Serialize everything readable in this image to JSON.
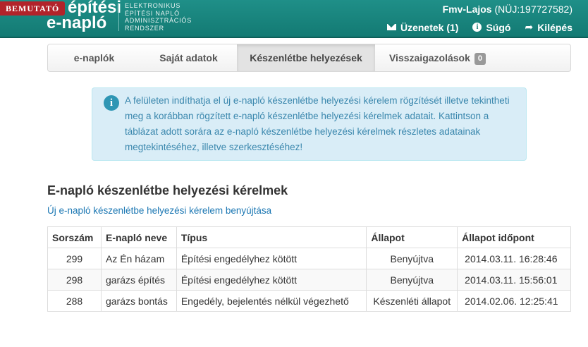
{
  "header": {
    "badge": "BEMUTATÓ",
    "logo_line1": "építési",
    "logo_line2": "e-napló",
    "logo_sub": [
      "ELEKTRONIKUS",
      "ÉPÍTÉSI NAPLÓ",
      "ADMINISZTRÁCIÓS",
      "RENDSZER"
    ],
    "user_name": "Fmv-Lajos",
    "user_id": "(NÜJ:197727582)",
    "nav": {
      "messages": "Üzenetek (1)",
      "help": "Súgó",
      "logout": "Kilépés"
    }
  },
  "tabs": [
    {
      "label": "e-naplók"
    },
    {
      "label": "Saját adatok"
    },
    {
      "label": "Készenlétbe helyezések"
    },
    {
      "label": "Visszaigazolások",
      "count": "0"
    }
  ],
  "info": {
    "icon": "info-icon",
    "text": "A felületen indíthatja el új e-napló készenlétbe helyezési kérelem rögzítését illetve tekintheti meg a korábban rögzített e-napló készenlétbe helyezési kérelmek adatait. Kattintson a táblázat adott sorára az e-napló készenlétbe helyezési kérelmek részletes adatainak megtekintéséhez, illetve szerkesztéséhez!"
  },
  "section": {
    "title": "E-napló készenlétbe helyezési kérelmek",
    "new_link": "Új e-napló készenlétbe helyezési kérelem benyújtása"
  },
  "table": {
    "columns": [
      "Sorszám",
      "E-napló neve",
      "Típus",
      "Állapot",
      "Állapot időpont"
    ],
    "rows": [
      {
        "num": "299",
        "name": "Az Én házam",
        "type": "Építési engedélyhez kötött",
        "state": "Benyújtva",
        "time": "2014.03.11. 16:28:46"
      },
      {
        "num": "298",
        "name": "garázs építés",
        "type": "Építési engedélyhez kötött",
        "state": "Benyújtva",
        "time": "2014.03.11. 15:56:01"
      },
      {
        "num": "288",
        "name": "garázs bontás",
        "type": "Engedély, bejelentés nélkül végezhető",
        "state": "Készenléti állapot",
        "time": "2014.02.06. 12:25:41"
      }
    ]
  },
  "colors": {
    "header": "#137a73",
    "badge": "#b2232a",
    "info_bg": "#d9edf7",
    "info_text": "#3a87ad",
    "link": "#1b77b3"
  }
}
